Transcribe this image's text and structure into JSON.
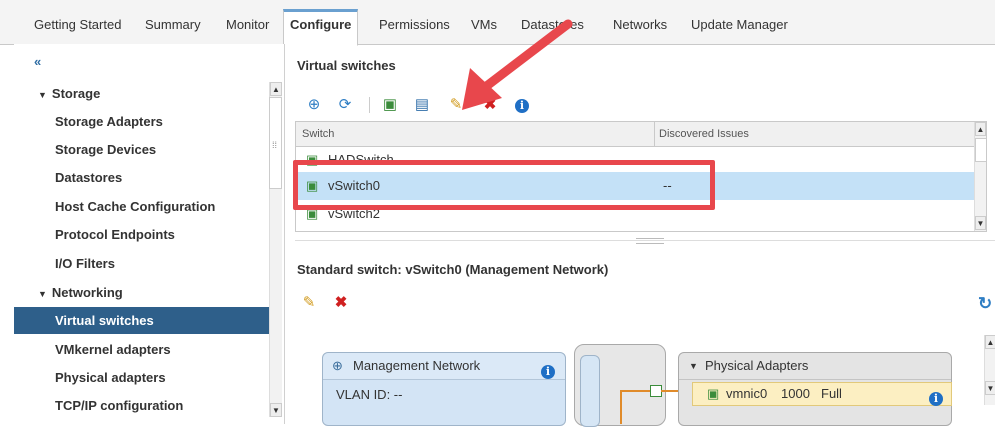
{
  "tabs": [
    "Getting Started",
    "Summary",
    "Monitor",
    "Configure",
    "Permissions",
    "VMs",
    "Datastores",
    "Networks",
    "Update Manager"
  ],
  "active_tab": "Configure",
  "sidebar": {
    "collapse_glyph": "«",
    "sections": [
      {
        "label": "Storage",
        "items": [
          "Storage Adapters",
          "Storage Devices",
          "Datastores",
          "Host Cache Configuration",
          "Protocol Endpoints",
          "I/O Filters"
        ]
      },
      {
        "label": "Networking",
        "items": [
          "Virtual switches",
          "VMkernel adapters",
          "Physical adapters",
          "TCP/IP configuration"
        ]
      }
    ],
    "selected_item": "Virtual switches"
  },
  "virtual_switches": {
    "title": "Virtual switches",
    "columns": [
      "Switch",
      "Discovered Issues"
    ],
    "rows": [
      {
        "name": "HADSwitch",
        "issues": ""
      },
      {
        "name": "vSwitch0",
        "issues": "--"
      },
      {
        "name": "vSwitch2",
        "issues": ""
      }
    ],
    "selected_row": "vSwitch0",
    "toolbar_icons": [
      "add-host-networking-icon",
      "refresh-icon",
      "migrate-adapter-icon",
      "view-settings-icon",
      "edit-pencil-icon",
      "delete-x-icon",
      "info-icon"
    ]
  },
  "standard_switch": {
    "title": "Standard switch: vSwitch0 (Management Network)",
    "port_group": {
      "name": "Management Network",
      "vlan": "VLAN ID: --"
    },
    "physical_adapters": {
      "label": "Physical Adapters",
      "adapter": "vmnic0",
      "speed": "1000",
      "duplex": "Full"
    }
  },
  "colors": {
    "selection": "#2e5f8a",
    "row_highlight": "#c4e1f7",
    "annotation_red": "#e8474c",
    "info_blue": "#1f6fc5"
  }
}
